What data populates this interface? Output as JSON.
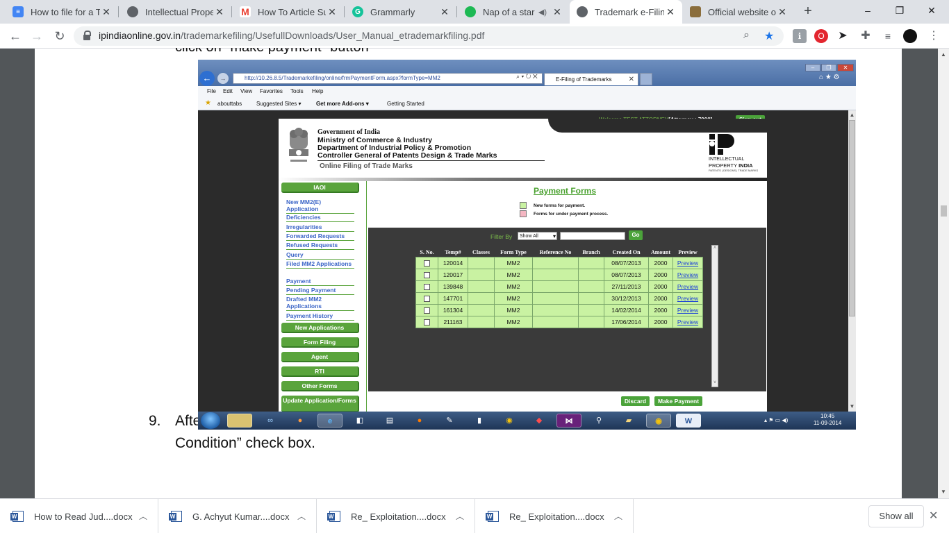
{
  "browser": {
    "tabs": [
      {
        "title": "How to file for a Tr",
        "icon": "docs-icon",
        "color": "#4285f4"
      },
      {
        "title": "Intellectual Proper",
        "icon": "globe-icon",
        "color": "#5f6368"
      },
      {
        "title": "How To Article Sub",
        "icon": "gmail-icon",
        "color": "#ea4335"
      },
      {
        "title": "Grammarly",
        "icon": "grammarly-icon",
        "color": "#15c39a"
      },
      {
        "title": "Nap of a star",
        "icon": "spotify-icon",
        "color": "#1db954"
      },
      {
        "title": "Trademark e-Filing",
        "icon": "globe-icon",
        "color": "#5f6368"
      },
      {
        "title": "Official website of",
        "icon": "emblem-icon",
        "color": "#8a6d3b"
      }
    ],
    "active_tab": 5,
    "new_tab": "+",
    "window_controls": {
      "minimize": "–",
      "restore": "❐",
      "close": "✕"
    },
    "nav": {
      "back": "←",
      "forward": "→",
      "reload": "↻"
    },
    "url_host": "ipindiaonline.gov.in",
    "url_path": "/trademarkefiling/UsefullDownloads/User_Manual_etrademarkfiling.pdf"
  },
  "pdf": {
    "cut_text": "click on \"make payment\" button",
    "step_number": "9.",
    "step_text": "After clicking make payment button then show select application payment detail and “term & Condition” check box."
  },
  "screenshot": {
    "ie": {
      "address": "http://10.26.8.5/Trademarkefiling/online/frmPaymentForm.aspx?formType=MM2",
      "tab_title": "E-Filing of Trademarks",
      "menu": [
        "File",
        "Edit",
        "View",
        "Favorites",
        "Tools",
        "Help"
      ],
      "favorites": [
        "abouttabs",
        "Suggested Sites ▾",
        "Get more Add-ons ▾",
        "Getting Started"
      ]
    },
    "welcome": "Welcome TEST ATTORNEY",
    "attorney": "[Attorney : 7900]",
    "sign_out": "Sign out",
    "header": {
      "gov": "Government of India",
      "line1": "Ministry of Commerce & Industry",
      "line2": "Department of Industrial Policy & Promotion",
      "line3": "Controller General of Patents Design & Trade Marks",
      "subtitle": "Online Filing of Trade Marks",
      "logo_line1": "INTELLECTUAL",
      "logo_line2a": "PROPERTY ",
      "logo_line2b": "INDIA",
      "logo_line3": "PATENTS | DESIGNS | TRADE MARKS"
    },
    "leftnav": {
      "iaoi": "IAOI",
      "links": [
        "New MM2(E) Application",
        "Deficiencies",
        "Irregularities",
        "Forwarded Requests",
        "Refused Requests",
        "Query",
        "Filed MM2 Applications",
        "Payment",
        "Pending Payment",
        "Drafted MM2 Applications",
        "Payment History"
      ],
      "buttons": [
        "New Applications",
        "Form Filing",
        "Agent",
        "RTI",
        "Other Forms",
        "Update Application/Forms"
      ]
    },
    "payment": {
      "title": "Payment Forms",
      "legend_new": "New forms for payment.",
      "legend_under": "Forms for under payment process.",
      "legend_new_color": "#c9f2a2",
      "legend_under_color": "#f4b6c2",
      "filter_label": "Filter By",
      "filter_value": "Show All",
      "go": "Go",
      "columns": [
        "S. No.",
        "Temp#",
        "Classes",
        "Form Type",
        "Reference No",
        "Branch",
        "Created On",
        "Amount",
        "Preview"
      ],
      "rows": [
        {
          "temp": "120014",
          "classes": "",
          "form": "MM2",
          "ref": "",
          "branch": "",
          "created": "08/07/2013",
          "amount": "2000",
          "preview": "Preview"
        },
        {
          "temp": "120017",
          "classes": "",
          "form": "MM2",
          "ref": "",
          "branch": "",
          "created": "08/07/2013",
          "amount": "2000",
          "preview": "Preview"
        },
        {
          "temp": "139848",
          "classes": "",
          "form": "MM2",
          "ref": "",
          "branch": "",
          "created": "27/11/2013",
          "amount": "2000",
          "preview": "Preview"
        },
        {
          "temp": "147701",
          "classes": "",
          "form": "MM2",
          "ref": "",
          "branch": "",
          "created": "30/12/2013",
          "amount": "2000",
          "preview": "Preview"
        },
        {
          "temp": "161304",
          "classes": "",
          "form": "MM2",
          "ref": "",
          "branch": "",
          "created": "14/02/2014",
          "amount": "2000",
          "preview": "Preview"
        },
        {
          "temp": "211163",
          "classes": "",
          "form": "MM2",
          "ref": "",
          "branch": "",
          "created": "17/06/2014",
          "amount": "2000",
          "preview": "Preview"
        }
      ],
      "discard": "Discard",
      "make_payment": "Make Payment"
    },
    "taskbar": {
      "time": "10:45",
      "date": "11-09-2014"
    }
  },
  "downloads": {
    "items": [
      "How to Read Jud....docx",
      "G. Achyut Kumar....docx",
      "Re_ Exploitation....docx",
      "Re_ Exploitation....docx"
    ],
    "show_all": "Show all"
  }
}
